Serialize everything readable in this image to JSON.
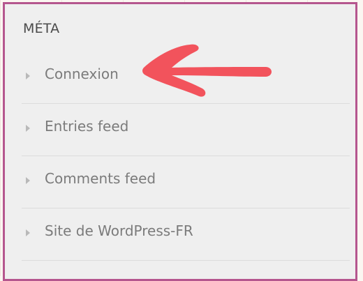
{
  "widget": {
    "title": "MÉTA",
    "items": [
      {
        "label": "Connexion"
      },
      {
        "label": "Entries feed"
      },
      {
        "label": "Comments feed"
      },
      {
        "label": "Site de WordPress-FR"
      }
    ]
  },
  "colors": {
    "frame": "#b5568e",
    "annotation_arrow": "#f2535c"
  },
  "icons": {
    "item_bullet": "triangle-right-icon",
    "annotation": "arrow-left-annotation"
  }
}
